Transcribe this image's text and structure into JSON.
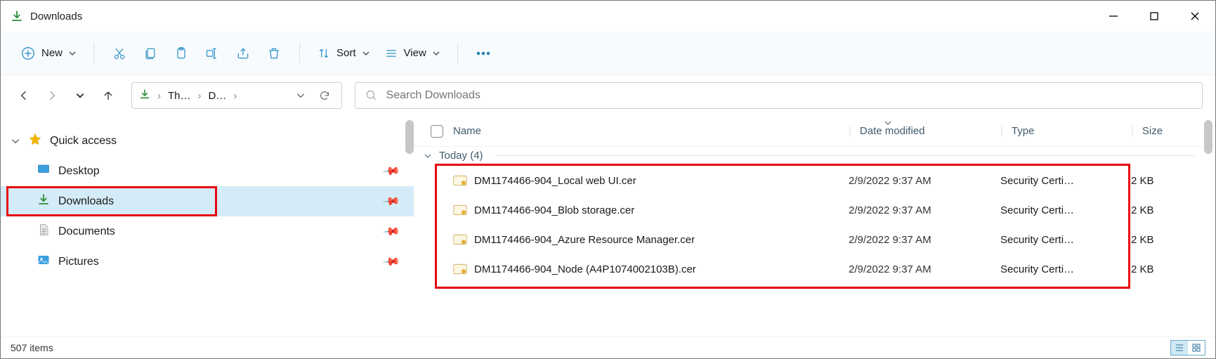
{
  "window": {
    "title": "Downloads"
  },
  "toolbar": {
    "new_label": "New",
    "sort_label": "Sort",
    "view_label": "View"
  },
  "breadcrumb": {
    "seg1": "Th…",
    "seg2": "D…"
  },
  "search": {
    "placeholder": "Search Downloads"
  },
  "sidebar": {
    "quick_access": "Quick access",
    "desktop": "Desktop",
    "downloads": "Downloads",
    "documents": "Documents",
    "pictures": "Pictures"
  },
  "columns": {
    "name": "Name",
    "date": "Date modified",
    "type": "Type",
    "size": "Size"
  },
  "group": {
    "today": "Today (4)"
  },
  "files": [
    {
      "name": "DM1174466-904_Local web UI.cer",
      "date": "2/9/2022 9:37 AM",
      "type": "Security Certi…",
      "size": "2 KB"
    },
    {
      "name": "DM1174466-904_Blob storage.cer",
      "date": "2/9/2022 9:37 AM",
      "type": "Security Certi…",
      "size": "2 KB"
    },
    {
      "name": "DM1174466-904_Azure Resource Manager.cer",
      "date": "2/9/2022 9:37 AM",
      "type": "Security Certi…",
      "size": "2 KB"
    },
    {
      "name": "DM1174466-904_Node (A4P1074002103B).cer",
      "date": "2/9/2022 9:37 AM",
      "type": "Security Certi…",
      "size": "2 KB"
    }
  ],
  "status": {
    "items": "507 items"
  }
}
